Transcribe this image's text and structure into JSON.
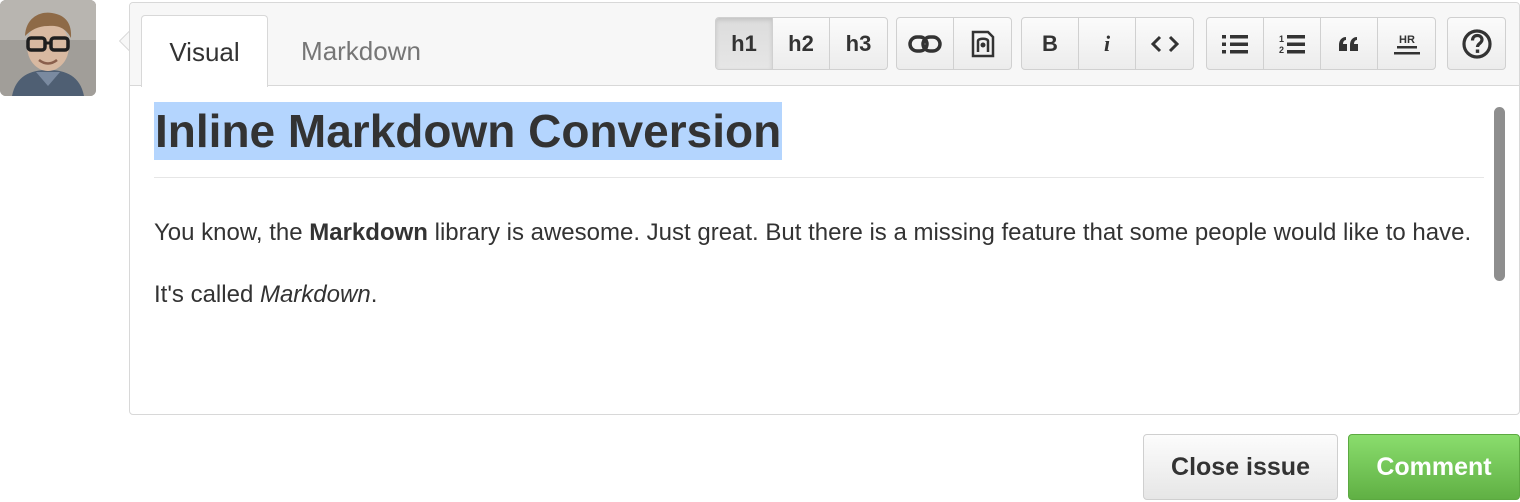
{
  "tabs": {
    "visual": "Visual",
    "markdown": "Markdown"
  },
  "toolbar": {
    "heading_buttons": [
      "h1",
      "h2",
      "h3"
    ],
    "bold": "B",
    "italic": "i",
    "hr_label": "HR",
    "ordered_nums": [
      "1",
      "2"
    ]
  },
  "content": {
    "title": "Inline Markdown Conversion",
    "para1_before": "You know, the ",
    "para1_bold": "Markdown",
    "para1_after": " library is awesome. Just great. But there is a missing feature that some people would like to have.",
    "para2_before": "It's called ",
    "para2_italic": "Markdown",
    "para2_after": "."
  },
  "actions": {
    "close": "Close issue",
    "comment": "Comment"
  },
  "colors": {
    "selection": "#b4d5fe",
    "comment_green": "#6cc644"
  }
}
